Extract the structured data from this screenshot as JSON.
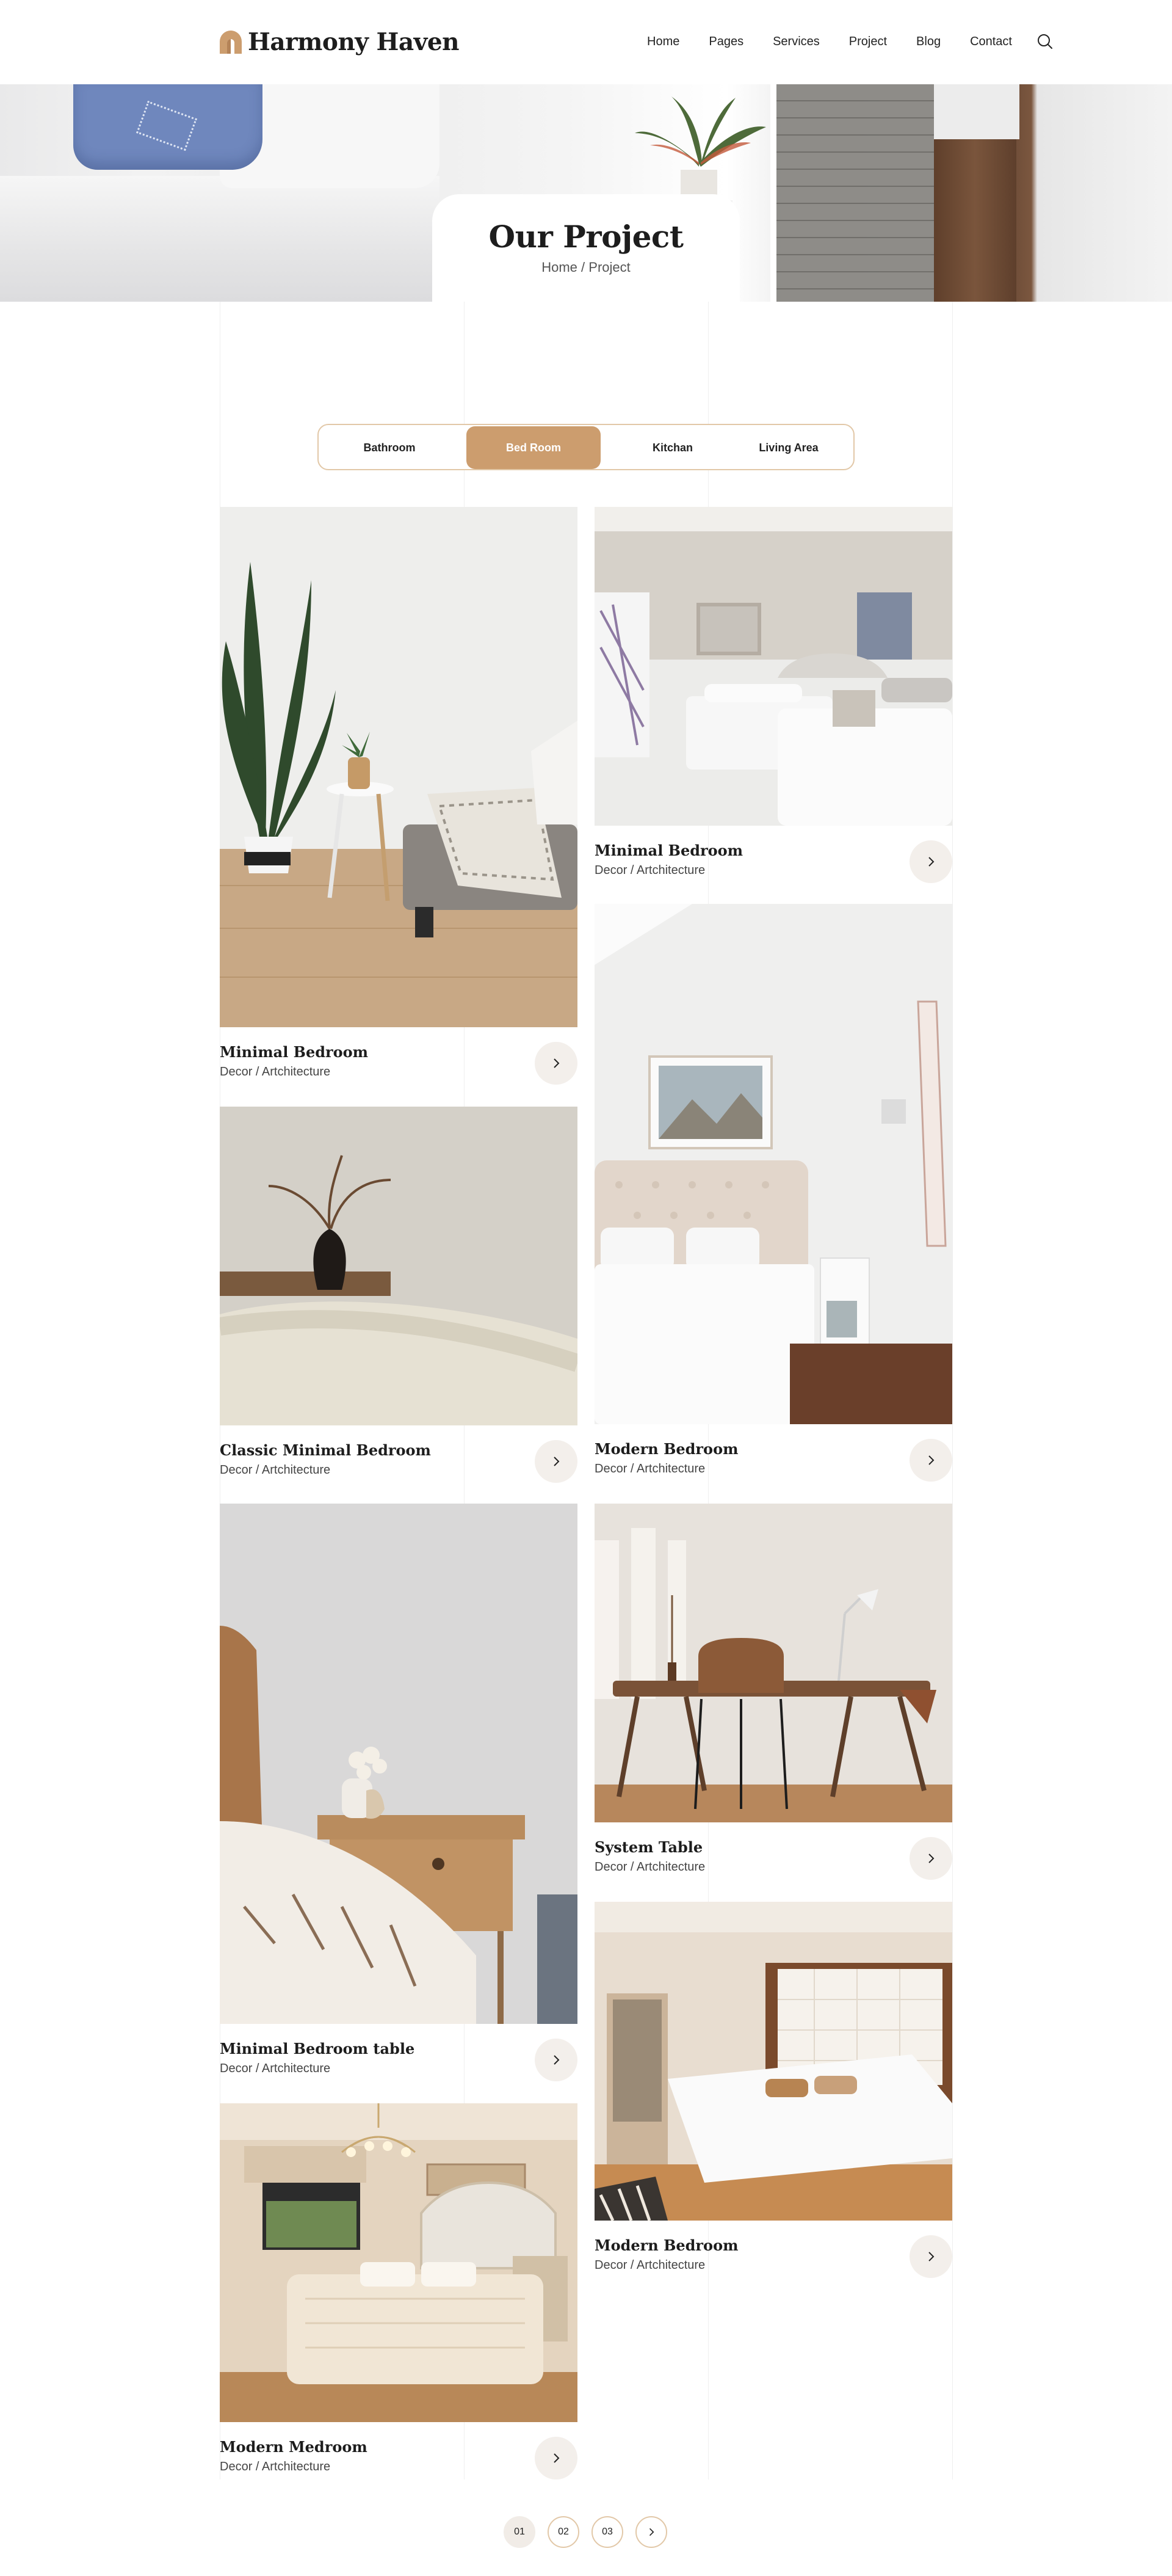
{
  "brand": {
    "name": "Harmony Haven",
    "accent": "#cc9d6e"
  },
  "nav": {
    "items": [
      "Home",
      "Pages",
      "Services",
      "Project",
      "Blog",
      "Contact"
    ],
    "search_icon": "search-icon"
  },
  "hero": {
    "title": "Our Project",
    "breadcrumb": {
      "home": "Home",
      "separator": "/",
      "current": "Project"
    }
  },
  "filters": {
    "tabs": [
      "Bathroom",
      "Bed Room",
      "Kitchan",
      "Living Area"
    ],
    "active": "Bed Room"
  },
  "projects": [
    {
      "title": "Minimal Bedroom",
      "category": "Decor / Artchitecture"
    },
    {
      "title": "Minimal Bedroom",
      "category": "Decor / Artchitecture"
    },
    {
      "title": "Classic Minimal Bedroom",
      "category": "Decor / Artchitecture"
    },
    {
      "title": "Modern Bedroom",
      "category": "Decor / Artchitecture"
    },
    {
      "title": "Minimal Bedroom table",
      "category": "Decor / Artchitecture"
    },
    {
      "title": "System Table",
      "category": "Decor / Artchitecture"
    },
    {
      "title": "Modern Medroom",
      "category": "Decor / Artchitecture"
    },
    {
      "title": "Modern Bedroom",
      "category": "Decor / Artchitecture"
    }
  ],
  "pagination": {
    "pages": [
      "01",
      "02",
      "03"
    ],
    "current": "01",
    "next_icon": "chevron-right-icon"
  }
}
